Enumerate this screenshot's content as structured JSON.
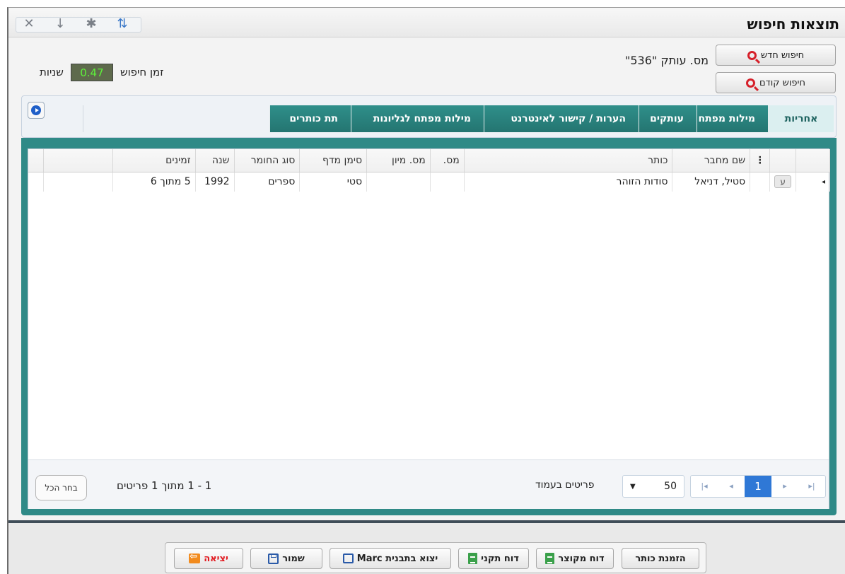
{
  "window": {
    "title": "תוצאות חיפוש",
    "tools": [
      "close-icon",
      "download-icon",
      "settings-icon",
      "sort-icon"
    ]
  },
  "search": {
    "new_search": "חיפוש חדש",
    "previous_search": "חיפוש קודם",
    "query": "מס. עותק \"536\"",
    "time_label": "זמן חיפוש",
    "time_value": "0.47",
    "time_unit": "שניות"
  },
  "tabs": [
    "אחריות",
    "מילות מפתח",
    "עותקים",
    "הערות / קישור לאינטרנט",
    "מילות מפתח לגליונות",
    "תת כותרים"
  ],
  "table": {
    "headers": {
      "author": "שם מחבר",
      "title": "כותר",
      "num": "מס.",
      "class_num": "מס. מיון",
      "shelf": "סימן מדף",
      "material": "סוג החומר",
      "year": "שנה",
      "available": "זמינים"
    },
    "rows": [
      {
        "badge": "ע",
        "author": "סטיל, דניאל",
        "title": "סודות הזוהר",
        "num": "",
        "class_num": "",
        "shelf": "סטי",
        "material": "ספרים",
        "year": "1992",
        "available": "5 מתוך 6"
      }
    ]
  },
  "pager": {
    "current_page": "1",
    "page_size": "50",
    "page_size_label": "פריטים בעמוד",
    "info": "1 - 1 מתוך 1 פריטים",
    "select_all": "בחר הכל"
  },
  "actions": {
    "order_title": "הזמנת כותר",
    "short_report": "דוח מקוצר",
    "standard_report": "דוח תקני",
    "export_marc": "יצוא בתבנית Marc",
    "save": "שמור",
    "exit": "יציאה"
  }
}
